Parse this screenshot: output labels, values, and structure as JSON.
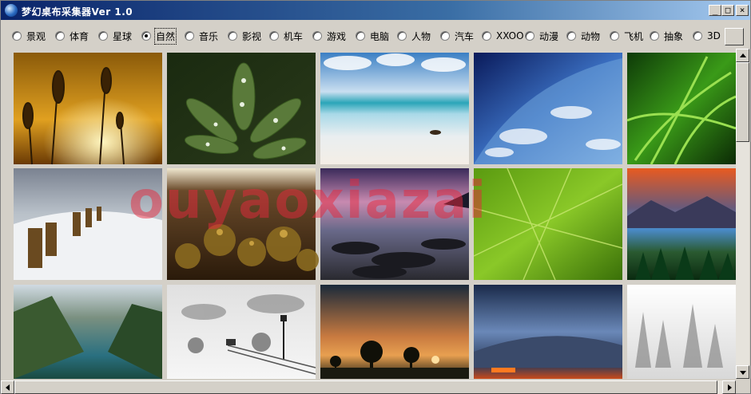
{
  "window": {
    "title": "梦幻桌布采集器Ver 1.0",
    "controls": [
      "_",
      "□",
      "×"
    ]
  },
  "categories": [
    {
      "label": "景观",
      "checked": false
    },
    {
      "label": "体育",
      "checked": false
    },
    {
      "label": "星球",
      "checked": false
    },
    {
      "label": "自然",
      "checked": true
    },
    {
      "label": "音乐",
      "checked": false
    },
    {
      "label": "影视",
      "checked": false
    },
    {
      "label": "机车",
      "checked": false
    },
    {
      "label": "游戏",
      "checked": false
    },
    {
      "label": "电脑",
      "checked": false
    },
    {
      "label": "人物",
      "checked": false
    },
    {
      "label": "汽车",
      "checked": false
    },
    {
      "label": "XXOO",
      "checked": false
    },
    {
      "label": "动漫",
      "checked": false
    },
    {
      "label": "动物",
      "checked": false
    },
    {
      "label": "飞机",
      "checked": false
    },
    {
      "label": "抽象",
      "checked": false
    },
    {
      "label": "3D",
      "checked": false
    }
  ],
  "watermark": "ouyaoxiazai",
  "thumbnails": [
    {
      "name": "thumb-reeds-sunset"
    },
    {
      "name": "thumb-leaf-dewdrops"
    },
    {
      "name": "thumb-beach-shore"
    },
    {
      "name": "thumb-earth-from-space"
    },
    {
      "name": "thumb-green-grass"
    },
    {
      "name": "thumb-wooden-groynes-surf"
    },
    {
      "name": "thumb-moss-macro"
    },
    {
      "name": "thumb-rocky-shore-dusk"
    },
    {
      "name": "thumb-green-leaf-veins"
    },
    {
      "name": "thumb-mountain-lake-sunset"
    },
    {
      "name": "thumb-fjord-valley"
    },
    {
      "name": "thumb-snowy-railway"
    },
    {
      "name": "thumb-sunset-trees"
    },
    {
      "name": "thumb-storm-clouds"
    },
    {
      "name": "thumb-frosted-trees"
    }
  ]
}
